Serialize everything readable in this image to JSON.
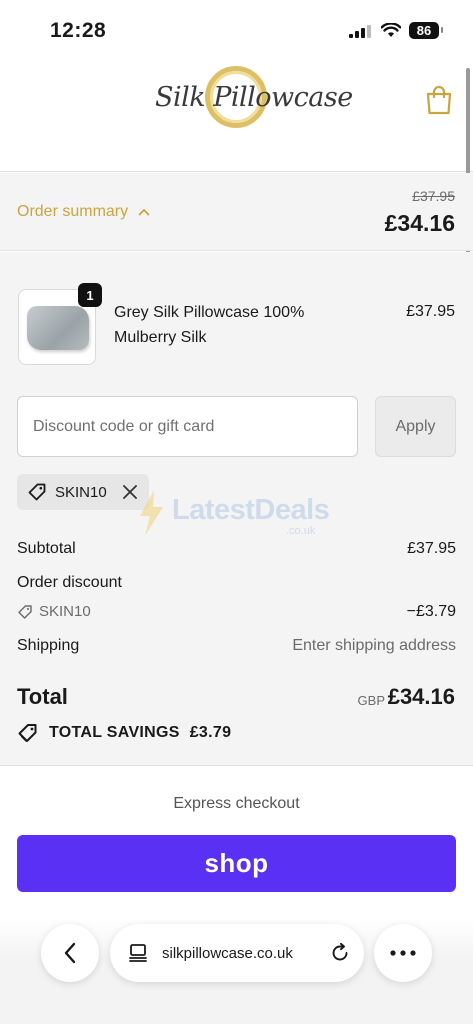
{
  "status_bar": {
    "time": "12:28",
    "battery": "86"
  },
  "header": {
    "logo_text": "Silk Pillowcase",
    "cart_icon": "shopping-bag-icon"
  },
  "summary": {
    "toggle_label": "Order summary",
    "original_price": "£37.95",
    "total_price": "£34.16"
  },
  "product": {
    "quantity": "1",
    "name": "Grey Silk Pillowcase 100% Mulberry Silk",
    "price": "£37.95"
  },
  "discount": {
    "placeholder": "Discount code or gift card",
    "apply_label": "Apply",
    "applied_code": "SKIN10"
  },
  "watermark": {
    "text": "LatestDeals",
    "sub": ".co.uk"
  },
  "totals": {
    "subtotal_label": "Subtotal",
    "subtotal_value": "£37.95",
    "order_discount_label": "Order discount",
    "discount_code": "SKIN10",
    "discount_value": "−£3.79",
    "shipping_label": "Shipping",
    "shipping_value": "Enter shipping address",
    "total_label": "Total",
    "currency": "GBP",
    "total_value": "£34.16",
    "savings_label": "TOTAL SAVINGS",
    "savings_value": "£3.79"
  },
  "express": {
    "label": "Express checkout",
    "shop_label": "shop"
  },
  "browser": {
    "url": "silkpillowcase.co.uk"
  },
  "colors": {
    "accent": "#c9a53f",
    "shop_purple": "#5a31f4"
  }
}
